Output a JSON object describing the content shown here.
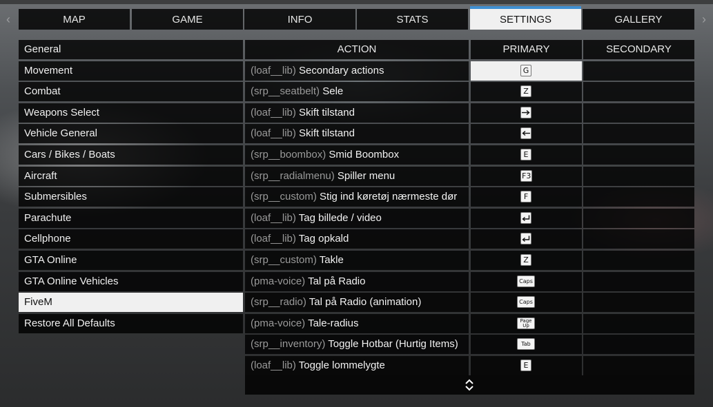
{
  "tabs": [
    {
      "label": "MAP",
      "active": false
    },
    {
      "label": "GAME",
      "active": false
    },
    {
      "label": "INFO",
      "active": false
    },
    {
      "label": "STATS",
      "active": false
    },
    {
      "label": "SETTINGS",
      "active": true
    },
    {
      "label": "GALLERY",
      "active": false
    }
  ],
  "sidebar": {
    "items": [
      {
        "label": "General",
        "active": false
      },
      {
        "label": "Movement",
        "active": false
      },
      {
        "label": "Combat",
        "active": false
      },
      {
        "label": "Weapons Select",
        "active": false
      },
      {
        "label": "Vehicle General",
        "active": false
      },
      {
        "label": "Cars / Bikes / Boats",
        "active": false
      },
      {
        "label": "Aircraft",
        "active": false
      },
      {
        "label": "Submersibles",
        "active": false
      },
      {
        "label": "Parachute",
        "active": false
      },
      {
        "label": "Cellphone",
        "active": false
      },
      {
        "label": "GTA Online",
        "active": false
      },
      {
        "label": "GTA Online Vehicles",
        "active": false
      },
      {
        "label": "FiveM",
        "active": true
      },
      {
        "label": "Restore All Defaults",
        "active": false
      }
    ]
  },
  "table": {
    "headers": {
      "action": "ACTION",
      "primary": "PRIMARY",
      "secondary": "SECONDARY"
    },
    "rows": [
      {
        "resource": "(loaf__lib)",
        "action": "Secondary actions",
        "primary": "G",
        "primary_icon": "",
        "secondary": "",
        "selected": true
      },
      {
        "resource": "(srp__seatbelt)",
        "action": "Sele",
        "primary": "Z",
        "primary_icon": "",
        "secondary": "",
        "selected": false
      },
      {
        "resource": "(loaf__lib)",
        "action": "Skift tilstand",
        "primary": "",
        "primary_icon": "arrow-right-icon",
        "secondary": "",
        "selected": false
      },
      {
        "resource": "(loaf__lib)",
        "action": "Skift tilstand",
        "primary": "",
        "primary_icon": "arrow-left-icon",
        "secondary": "",
        "selected": false
      },
      {
        "resource": "(srp__boombox)",
        "action": "Smid Boombox",
        "primary": "E",
        "primary_icon": "",
        "secondary": "",
        "selected": false
      },
      {
        "resource": "(srp__radialmenu)",
        "action": "Spiller menu",
        "primary": "F3",
        "primary_icon": "",
        "secondary": "",
        "selected": false
      },
      {
        "resource": "(srp__custom)",
        "action": "Stig ind køretøj nærmeste dør",
        "primary": "F",
        "primary_icon": "",
        "secondary": "",
        "selected": false
      },
      {
        "resource": "(loaf__lib)",
        "action": "Tag billede / video",
        "primary": "",
        "primary_icon": "enter-key-icon",
        "secondary": "",
        "selected": false
      },
      {
        "resource": "(loaf__lib)",
        "action": "Tag opkald",
        "primary": "",
        "primary_icon": "enter-key-icon",
        "secondary": "",
        "selected": false
      },
      {
        "resource": "(srp__custom)",
        "action": "Takle",
        "primary": "Z",
        "primary_icon": "",
        "secondary": "",
        "selected": false
      },
      {
        "resource": "(pma-voice)",
        "action": "Tal på Radio",
        "primary": "Caps",
        "primary_icon": "",
        "secondary": "",
        "selected": false
      },
      {
        "resource": "(srp__radio)",
        "action": "Tal på Radio (animation)",
        "primary": "Caps",
        "primary_icon": "",
        "secondary": "",
        "selected": false
      },
      {
        "resource": "(pma-voice)",
        "action": "Tale-radius",
        "primary": "Page Up",
        "primary_icon": "",
        "secondary": "",
        "selected": false
      },
      {
        "resource": "(srp__inventory)",
        "action": "Toggle Hotbar (Hurtig Items)",
        "primary": "Tab",
        "primary_icon": "",
        "secondary": "",
        "selected": false
      },
      {
        "resource": "(loaf__lib)",
        "action": "Toggle lommelygte",
        "primary": "E",
        "primary_icon": "",
        "secondary": "",
        "selected": false
      }
    ]
  },
  "icons": {
    "nav_left": "chevron-left-icon",
    "nav_right": "chevron-right-icon",
    "scroll": "scroll-up-down-icon"
  },
  "colors": {
    "accent": "#3e8fd2",
    "panel": "#000000",
    "active_bg": "#f0f0f0",
    "resource_text": "#9a9a9a"
  }
}
